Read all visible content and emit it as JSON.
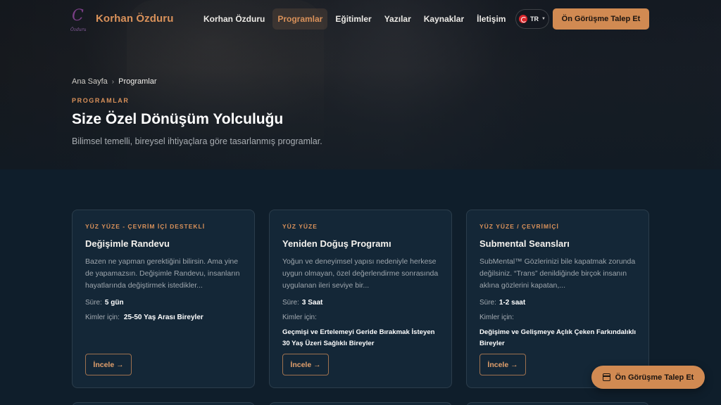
{
  "brand": {
    "name": "Korhan Özduru",
    "logo_mark": "C",
    "logo_sub": "Özduru"
  },
  "nav": {
    "items": [
      {
        "label": "Korhan Özduru"
      },
      {
        "label": "Programlar",
        "active": true
      },
      {
        "label": "Eğitimler"
      },
      {
        "label": "Yazılar"
      },
      {
        "label": "Kaynaklar"
      },
      {
        "label": "İletişim"
      }
    ],
    "language": "TR",
    "cta_label": "Ön Görüşme Talep Et"
  },
  "hero": {
    "breadcrumb": [
      "Ana Sayfa",
      "Programlar"
    ],
    "eyebrow": "PROGRAMLAR",
    "title": "Size Özel Dönüşüm Yolculuğu",
    "subtitle": "Bilimsel temelli, bireysel ihtiyaçlara göre tasarlanmış programlar."
  },
  "cards": [
    {
      "tag": "YÜZ YÜZE - ÇEVRİM İÇİ DESTEKLİ",
      "title": "Değişimle Randevu",
      "description": "Bazen ne yapman gerektiğini bilirsin. Ama yine de yapamazsın. Değişimle Randevu, insanların hayatlarında değiştirmek istedikler...",
      "duration_label": "Süre:",
      "duration_value": "5 gün",
      "for_label": "Kimler için:",
      "for_value": "25-50 Yaş Arası Bireyler",
      "button_label": "İncele →"
    },
    {
      "tag": "YÜZ YÜZE",
      "title": "Yeniden Doğuş Programı",
      "description": "Yoğun ve deneyimsel yapısı nedeniyle herkese uygun olmayan, özel değerlendirme sonrasında uygulanan ileri seviye bir...",
      "duration_label": "Süre:",
      "duration_value": "3 Saat",
      "for_label": "Kimler için:",
      "for_value": "Geçmişi ve Ertelemeyi Geride Bırakmak İsteyen 30 Yaş Üzeri Sağlıklı Bireyler",
      "button_label": "İncele →"
    },
    {
      "tag": "YÜZ YÜZE / ÇEVRİMİÇİ",
      "title": "Submental Seansları",
      "description": "SubMental™ Gözlerinizi bile kapatmak zorunda değilsiniz. “Trans” denildiğinde birçok insanın aklına gözlerini kapatan,...",
      "duration_label": "Süre:",
      "duration_value": "1-2 saat",
      "for_label": "Kimler için:",
      "for_value": "Değişime ve Gelişmeye Açlık Çeken Farkındalıklı Bireyler",
      "button_label": "İncele →"
    }
  ],
  "floating_cta": {
    "label": "Ön Görüşme Talep Et",
    "icon": "calendar-icon"
  },
  "colors": {
    "accent": "#d18a52",
    "background": "#0f1e2b",
    "card": "#142737"
  }
}
